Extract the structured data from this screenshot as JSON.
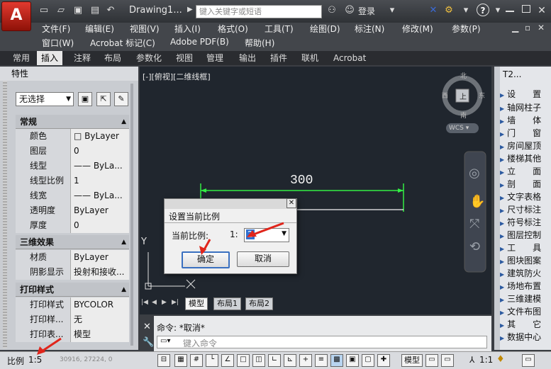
{
  "window": {
    "doc_title": "Drawing1...",
    "search_placeholder": "键入关键字或短语",
    "login": "登录",
    "help": "?"
  },
  "menu": {
    "row1": [
      "文件(F)",
      "编辑(E)",
      "视图(V)",
      "插入(I)",
      "格式(O)",
      "工具(T)",
      "绘图(D)",
      "标注(N)",
      "修改(M)",
      "参数(P)"
    ],
    "row2": [
      "窗口(W)",
      "Acrobat 标记(C)",
      "Adobe PDF(B)",
      "帮助(H)"
    ]
  },
  "ribbon_tabs": [
    "常用",
    "插入",
    "注释",
    "布局",
    "参数化",
    "视图",
    "管理",
    "输出",
    "插件",
    "联机",
    "Acrobat"
  ],
  "ribbon_active": "插入",
  "properties": {
    "title": "特性",
    "selection": "无选择",
    "sections": [
      {
        "header": "常规",
        "rows": [
          {
            "key": "颜色",
            "value": "□ ByLayer"
          },
          {
            "key": "图层",
            "value": "0"
          },
          {
            "key": "线型",
            "value": "—— ByLa..."
          },
          {
            "key": "线型比例",
            "value": "1"
          },
          {
            "key": "线宽",
            "value": "—— ByLa..."
          },
          {
            "key": "透明度",
            "value": "ByLayer"
          },
          {
            "key": "厚度",
            "value": "0"
          }
        ]
      },
      {
        "header": "三维效果",
        "rows": [
          {
            "key": "材质",
            "value": "ByLayer"
          },
          {
            "key": "阴影显示",
            "value": "投射和接收..."
          }
        ]
      },
      {
        "header": "打印样式",
        "rows": [
          {
            "key": "打印样式",
            "value": "BYCOLOR"
          },
          {
            "key": "打印样...",
            "value": "无"
          },
          {
            "key": "打印表...",
            "value": "模型"
          }
        ]
      }
    ]
  },
  "canvas": {
    "view_label": "[-][俯视][二维线框]",
    "dimension_text": "300",
    "compass": {
      "north": "北",
      "south": "南",
      "east": "东",
      "west": "西",
      "top": "上"
    },
    "wcs": "WCS",
    "axis_y": "Y",
    "axis_x": "X"
  },
  "layout_tabs": [
    "模型",
    "布局1",
    "布局2"
  ],
  "command": {
    "history": "命令: *取消*",
    "placeholder": "键入命令"
  },
  "right_panel": {
    "title": "T2...",
    "items": [
      "设　　置",
      "轴网柱子",
      "墙　　体",
      "门　　窗",
      "房间屋顶",
      "楼梯其他",
      "立　　面",
      "剖　　面",
      "文字表格",
      "尺寸标注",
      "符号标注",
      "图层控制",
      "工　　具",
      "图块图案",
      "建筑防火",
      "场地布置",
      "三维建模",
      "文件布图",
      "其　　它",
      "数据中心"
    ]
  },
  "status": {
    "scale_label": "比例",
    "scale_value": "1:5",
    "coords": "30916, 27224, 0",
    "model": "模型",
    "annot_scale": "1:1"
  },
  "dialog": {
    "title": "设置当前比例",
    "label": "当前比例:",
    "prefix": "1:",
    "value": "2",
    "ok": "确定",
    "cancel": "取消"
  },
  "colors": {
    "canvas_bg": "#20262e",
    "dimension": "#33ee44",
    "accent_red": "#e23a2f",
    "arrow": "#e0251b"
  }
}
